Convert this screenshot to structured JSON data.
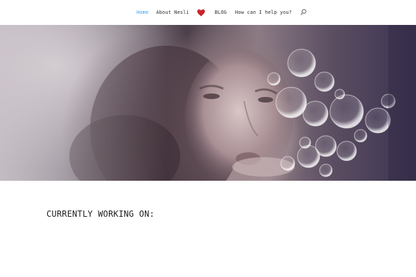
{
  "nav": {
    "items": [
      {
        "label": "Home",
        "active": true
      },
      {
        "label": "About Nesli"
      },
      {
        "label": "BLOG"
      },
      {
        "label": "How can I help you?"
      }
    ],
    "logo_icon": "heart-icon",
    "search_icon": "search-icon",
    "accent_color": "#2ea3f2",
    "heart_color": "#c8242b"
  },
  "hero": {
    "image_desc_icon": "woman-blowing-bubbles-photo"
  },
  "main": {
    "heading": "CURRENTLY WORKING ON:"
  }
}
